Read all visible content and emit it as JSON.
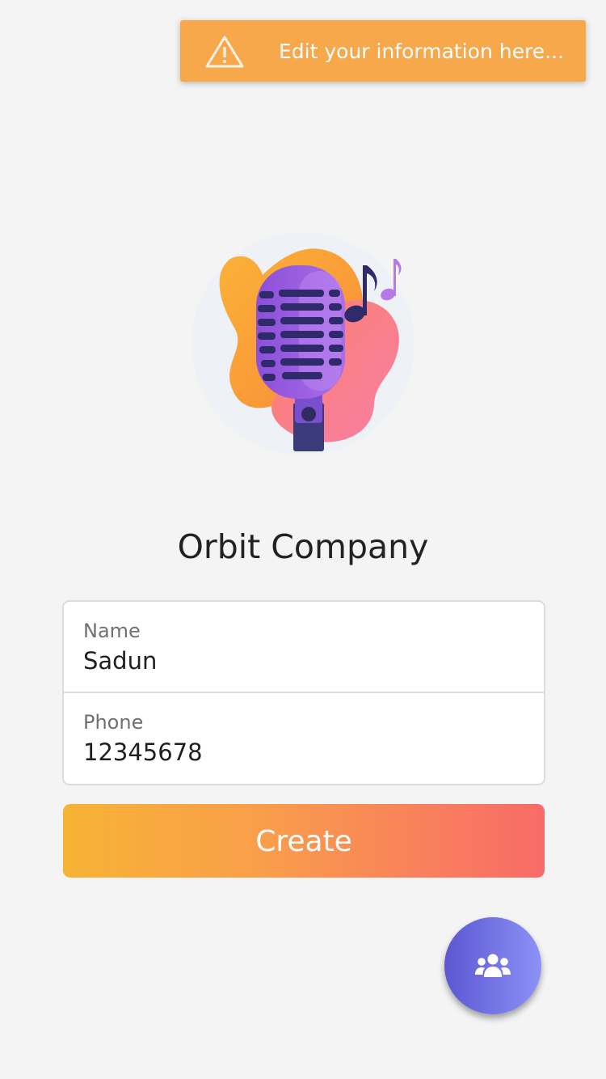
{
  "toast": {
    "message": "Edit your information here...",
    "icon": "warning-triangle-icon",
    "background_color": "#f6a84a"
  },
  "illustration": {
    "icon": "microphone-music-illustration"
  },
  "company": {
    "title": "Orbit Company"
  },
  "form": {
    "name": {
      "label": "Name",
      "value": "Sadun"
    },
    "phone": {
      "label": "Phone",
      "value": "12345678"
    }
  },
  "create_button": {
    "label": "Create",
    "gradient": [
      "#f6b334",
      "#f86b68"
    ]
  },
  "fab": {
    "icon": "users-group-icon",
    "gradient": [
      "#5b57d1",
      "#8d91f6"
    ]
  }
}
